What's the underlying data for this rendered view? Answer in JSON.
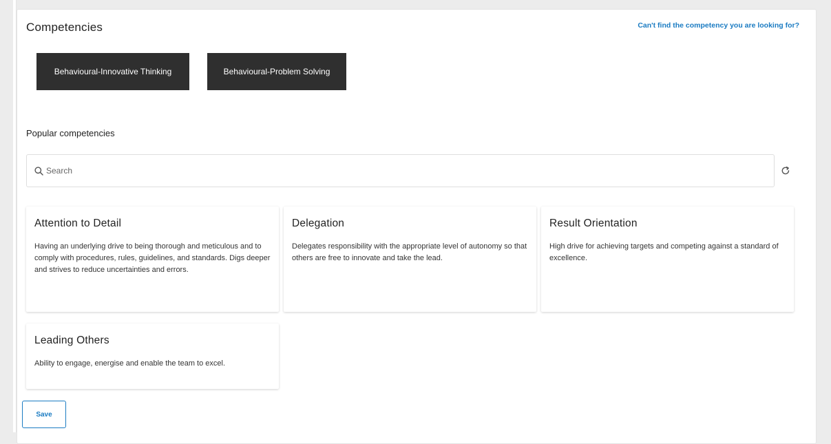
{
  "header": {
    "title": "Competencies",
    "help_link": "Can't find the competency you are looking for?"
  },
  "selected_competencies": [
    "Behavioural-Innovative Thinking",
    "Behavioural-Problem Solving"
  ],
  "popular": {
    "heading": "Popular competencies"
  },
  "search": {
    "placeholder": "Search",
    "value": ""
  },
  "icons": {
    "search": "search-icon",
    "refresh": "refresh-icon"
  },
  "cards": [
    {
      "title": "Attention to Detail",
      "description": "Having an underlying drive to being thorough and meticulous and to comply with procedures, rules, guidelines, and standards. Digs deeper and strives to reduce uncertainties and errors."
    },
    {
      "title": "Delegation",
      "description": "Delegates responsibility with the appropriate level of autonomy so that others are free to innovate and take the lead."
    },
    {
      "title": "Result Orientation",
      "description": "High drive for achieving targets and competing against a standard of excellence."
    },
    {
      "title": "Leading Others",
      "description": "Ability to engage, energise and enable the team to excel."
    }
  ],
  "actions": {
    "save_label": "Save"
  },
  "colors": {
    "chip_background": "#2f2f2f",
    "link_accent": "#1a7bc2",
    "page_background": "#ececec"
  }
}
